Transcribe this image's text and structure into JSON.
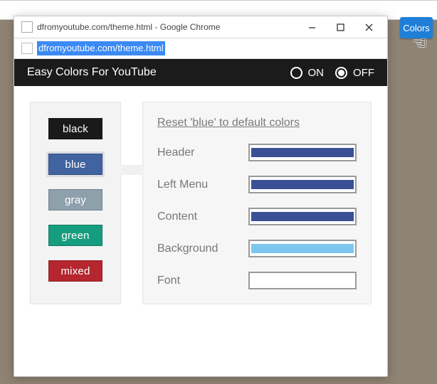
{
  "window": {
    "title": "dfromyoutube.com/theme.html - Google Chrome",
    "url": "dfromyoutube.com/theme.html"
  },
  "ext_button": {
    "label": "Colors"
  },
  "app": {
    "title": "Easy Colors For YouTube",
    "toggle": {
      "on_label": "ON",
      "off_label": "OFF",
      "value": "OFF"
    }
  },
  "themes": [
    {
      "id": "black",
      "label": "black",
      "selected": false
    },
    {
      "id": "blue",
      "label": "blue",
      "selected": true
    },
    {
      "id": "gray",
      "label": "gray",
      "selected": false
    },
    {
      "id": "green",
      "label": "green",
      "selected": false
    },
    {
      "id": "mixed",
      "label": "mixed",
      "selected": false
    }
  ],
  "panel": {
    "reset_label": "Reset 'blue' to default colors",
    "rows": [
      {
        "label": "Header",
        "color": "#3a5094"
      },
      {
        "label": "Left Menu",
        "color": "#3a5094"
      },
      {
        "label": "Content",
        "color": "#3a5094"
      },
      {
        "label": "Background",
        "color": "#7cc6ef"
      },
      {
        "label": "Font",
        "color": "#ffffff"
      }
    ]
  }
}
